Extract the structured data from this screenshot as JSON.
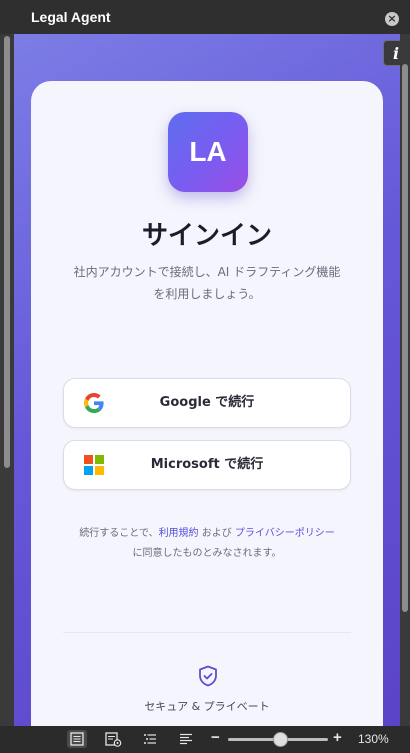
{
  "window": {
    "title": "Legal Agent"
  },
  "logo": {
    "text": "LA"
  },
  "signin": {
    "heading": "サインイン",
    "description_line1": "社内アカウントで接続し、AI ドラフティング機能",
    "description_line2": "を利用しましょう。"
  },
  "buttons": {
    "google_label": "Google で続行",
    "microsoft_label": "Microsoft で続行"
  },
  "terms": {
    "prefix": "続行することで、",
    "terms_link": "利用規約",
    "conjunction": " および ",
    "privacy_link": "プライバシーポリシー",
    "suffix": "に同意したものとみなされます。"
  },
  "features": [
    {
      "icon": "shield-check-icon",
      "label": "セキュア & プライベート"
    },
    {
      "icon": "lightning-icon",
      "label": ""
    }
  ],
  "statusbar": {
    "icons": [
      "page-view-icon",
      "page-settings-icon",
      "outline-list-icon",
      "text-align-icon"
    ],
    "zoom_level": "130%",
    "zoom_fraction": 0.52
  },
  "colors": {
    "accent": "#5a4fd6",
    "gradient_start": "#7c7de6",
    "gradient_end": "#5b43c7",
    "card_background": "#f5f5fd"
  }
}
